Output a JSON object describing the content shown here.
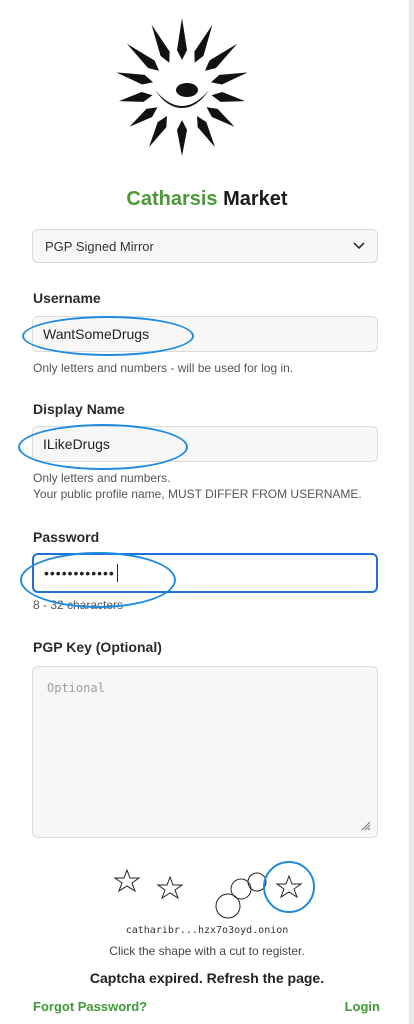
{
  "brand": {
    "part1": "Catharsis",
    "part2": "Market"
  },
  "mirror_select": {
    "value": "PGP Signed Mirror"
  },
  "username": {
    "label": "Username",
    "value": "WantSomeDrugs",
    "help": "Only letters and numbers - will be used for log in."
  },
  "display_name": {
    "label": "Display Name",
    "value": "ILikeDrugs",
    "help1": "Only letters and numbers.",
    "help2": "Your public profile name, MUST DIFFER FROM USERNAME."
  },
  "password": {
    "label": "Password",
    "value": "••••••••••••",
    "help": "8 - 32 characters"
  },
  "pgp": {
    "label": "PGP Key (Optional)",
    "placeholder": "Optional"
  },
  "captcha": {
    "onion": "catharibr...hzx7o3oyd.onion",
    "instruction": "Click the shape with a cut to register.",
    "status": "Captcha expired. Refresh the page."
  },
  "footer": {
    "forgot": "Forgot Password?",
    "login": "Login"
  },
  "colors": {
    "accent": "#4a9a3a",
    "focus": "#1f6fd8",
    "annotation": "#1e8be0"
  },
  "icons": [
    "logo-sun-eye-icon",
    "chevron-down-icon",
    "resize-grip-icon",
    "star-icon",
    "circle-icon"
  ]
}
